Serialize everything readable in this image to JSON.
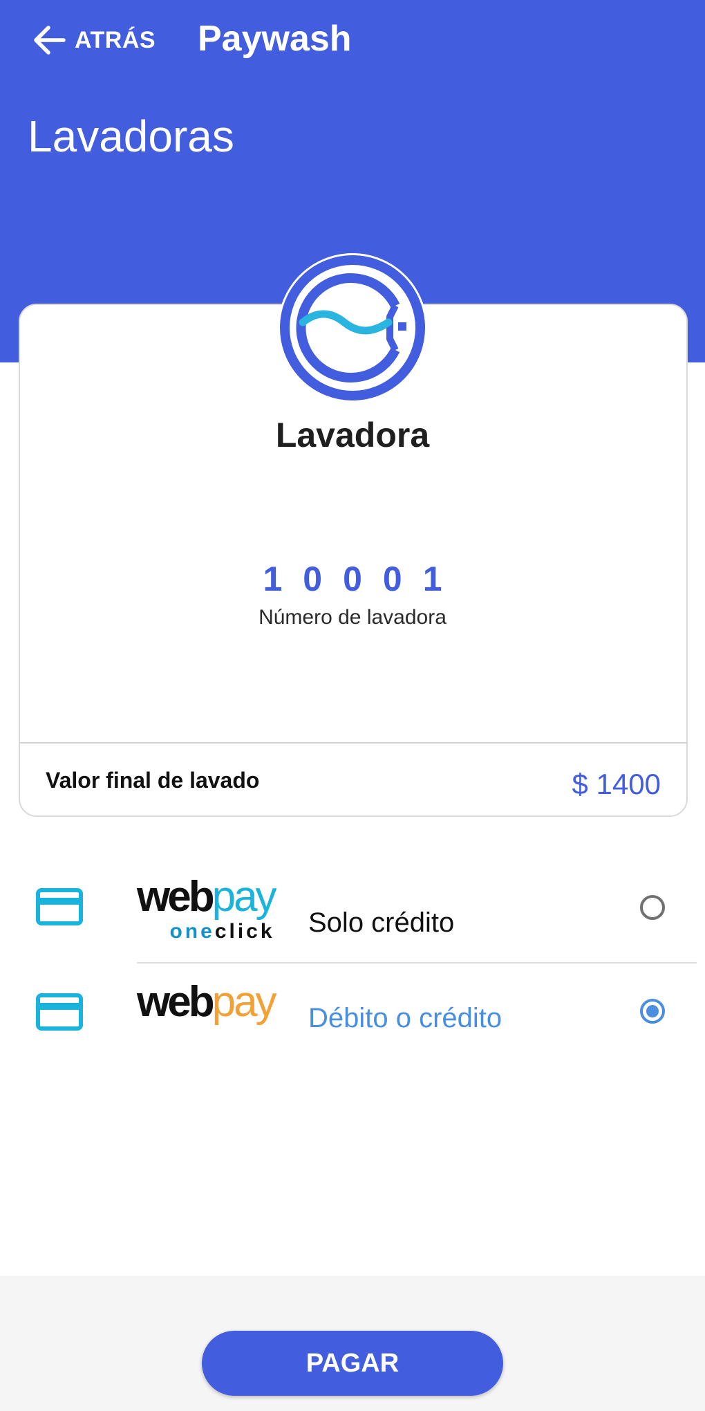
{
  "header": {
    "back_label": "ATRÁS",
    "app_title": "Paywash",
    "section_title": "Lavadoras",
    "bg_color": "#425ddd"
  },
  "machine": {
    "icon": "washing-machine-icon",
    "type": "Lavadora",
    "number": "10001",
    "number_label": "Número de lavadora"
  },
  "price": {
    "label": "Valor final de lavado",
    "value": "$ 1400"
  },
  "payment_options": [
    {
      "icon": "credit-card-icon",
      "logo_main": "web",
      "logo_accent": "pay",
      "logo_sub_one": "one",
      "logo_sub_click": "click",
      "label": "Solo crédito",
      "selected": false
    },
    {
      "icon": "credit-card-icon",
      "logo_main": "web",
      "logo_accent": "pay",
      "label": "Débito o crédito",
      "selected": true
    }
  ],
  "colors": {
    "accent": "#425ddd",
    "card_icon": "#1ab3dc",
    "wave": "#29b5e0",
    "oneclick_pay": "#1ab3dc",
    "webpay_pay": "#f3a034",
    "selected_label": "#4a8ee0",
    "radio_selected": "#4a8ee0",
    "radio_unselected": "#707070"
  },
  "footer": {
    "pay_button_label": "PAGAR"
  }
}
